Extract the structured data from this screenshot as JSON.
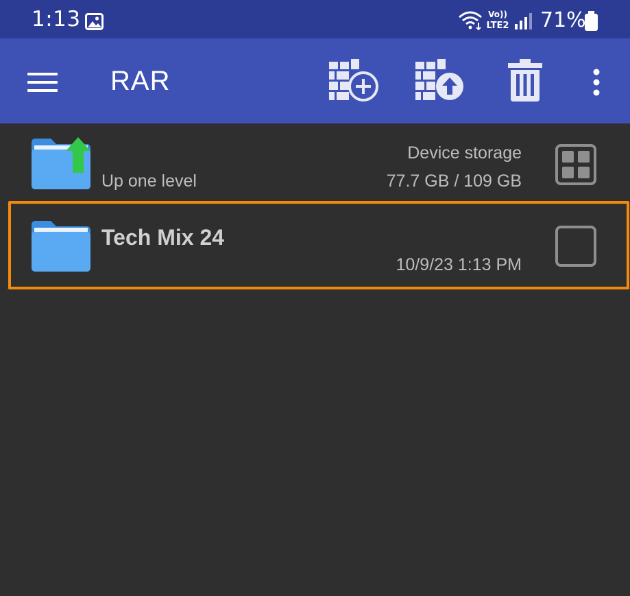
{
  "status_bar": {
    "time": "1:13",
    "gallery_icon": "image-icon",
    "wifi_icon": "wifi-icon",
    "volte_line1": "Vo))",
    "volte_line2": "LTE2",
    "signal_icon": "signal-icon",
    "battery_percent": "71%",
    "battery_icon": "battery-icon"
  },
  "toolbar": {
    "menu_icon": "menu-icon",
    "title": "RAR",
    "add_to_archive_icon": "archive-add-icon",
    "extract_icon": "archive-extract-icon",
    "delete_icon": "trash-icon",
    "more_icon": "more-vertical-icon"
  },
  "list": {
    "up_item": {
      "label": "Up one level",
      "storage_name": "Device storage",
      "storage_size": "77.7 GB / 109 GB",
      "icon": "folder-up-icon",
      "action_icon": "grid-view-icon"
    },
    "items": [
      {
        "name": "Tech Mix 24",
        "date": "10/9/23 1:13 PM",
        "icon": "folder-icon",
        "selected": false
      }
    ]
  },
  "colors": {
    "status_bar": "#2c3b93",
    "toolbar": "#3e52b6",
    "background": "#2f2f2f",
    "highlight": "#f28a0c",
    "folder": "#5aa9f3",
    "up_arrow": "#34c84a"
  }
}
